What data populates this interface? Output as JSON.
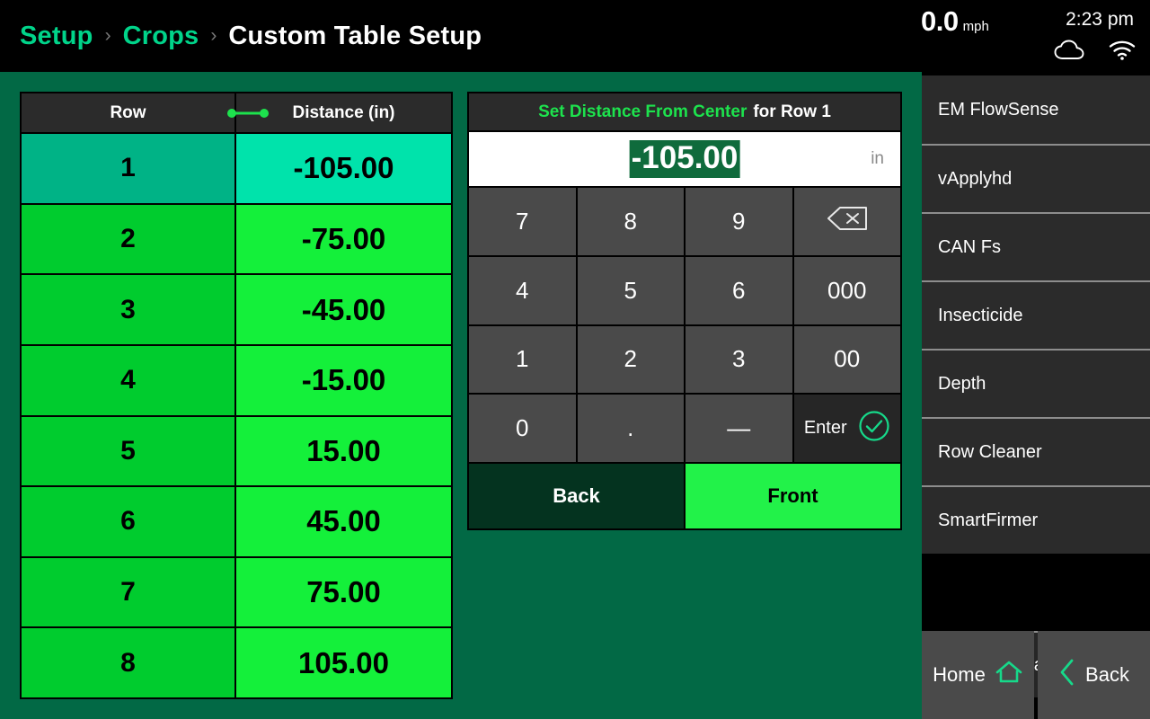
{
  "topbar": {
    "breadcrumb": [
      {
        "label": "Setup",
        "type": "link"
      },
      {
        "label": "Crops",
        "type": "link"
      },
      {
        "label": "Custom Table Setup",
        "type": "current"
      }
    ],
    "separator": "›",
    "speed_value": "0.0",
    "speed_unit": "mph",
    "time": "2:23 pm",
    "icons": [
      "cloud-icon",
      "wifi-icon"
    ]
  },
  "table": {
    "columns": {
      "row": "Row",
      "distance": "Distance (in)"
    },
    "span_icon": "distance-span-icon",
    "selected_row_index": 0,
    "rows": [
      {
        "row": "1",
        "distance": "-105.00"
      },
      {
        "row": "2",
        "distance": "-75.00"
      },
      {
        "row": "3",
        "distance": "-45.00"
      },
      {
        "row": "4",
        "distance": "-15.00"
      },
      {
        "row": "5",
        "distance": "15.00"
      },
      {
        "row": "6",
        "distance": "45.00"
      },
      {
        "row": "7",
        "distance": "75.00"
      },
      {
        "row": "8",
        "distance": "105.00"
      }
    ]
  },
  "entry": {
    "title_green": "Set Distance From Center",
    "title_white": "for Row 1",
    "value": "-105.00",
    "unit": "in",
    "keys": [
      {
        "label": "7",
        "name": "key-7"
      },
      {
        "label": "8",
        "name": "key-8"
      },
      {
        "label": "9",
        "name": "key-9"
      },
      {
        "label": "",
        "name": "key-backspace",
        "icon": "backspace-icon"
      },
      {
        "label": "4",
        "name": "key-4"
      },
      {
        "label": "5",
        "name": "key-5"
      },
      {
        "label": "6",
        "name": "key-6"
      },
      {
        "label": "000",
        "name": "key-000"
      },
      {
        "label": "1",
        "name": "key-1"
      },
      {
        "label": "2",
        "name": "key-2"
      },
      {
        "label": "3",
        "name": "key-3"
      },
      {
        "label": "00",
        "name": "key-00"
      },
      {
        "label": "0",
        "name": "key-0"
      },
      {
        "label": ".",
        "name": "key-decimal"
      },
      {
        "label": "—",
        "name": "key-minus"
      },
      {
        "label": "Enter",
        "name": "key-enter",
        "icon": "check-circle-icon"
      }
    ],
    "back_label": "Back",
    "front_label": "Front",
    "position_selected": "Front"
  },
  "sidebar": {
    "items": [
      {
        "label": "EM FlowSense"
      },
      {
        "label": "vApplyhd"
      },
      {
        "label": "CAN Fs"
      },
      {
        "label": "Insecticide"
      },
      {
        "label": "Depth"
      },
      {
        "label": "Row Cleaner"
      },
      {
        "label": "SmartFirmer"
      }
    ],
    "restore_label": "Restore Default",
    "restore_icon": "undo-arrow-icon",
    "home_label": "Home",
    "home_icon": "home-icon",
    "back_label": "Back",
    "back_icon": "chevron-left-icon"
  },
  "colors": {
    "background": "#026945",
    "accent_green": "#00D48A",
    "row_cell": "#00CC2E",
    "distance_cell": "#14F03A",
    "selected_row_cell": "#00B386",
    "selected_distance_cell": "#00E3AB",
    "selection_highlight": "#0F6B3C",
    "panel_dark": "#2B2B2B",
    "key_gray": "#4A4A4A"
  }
}
